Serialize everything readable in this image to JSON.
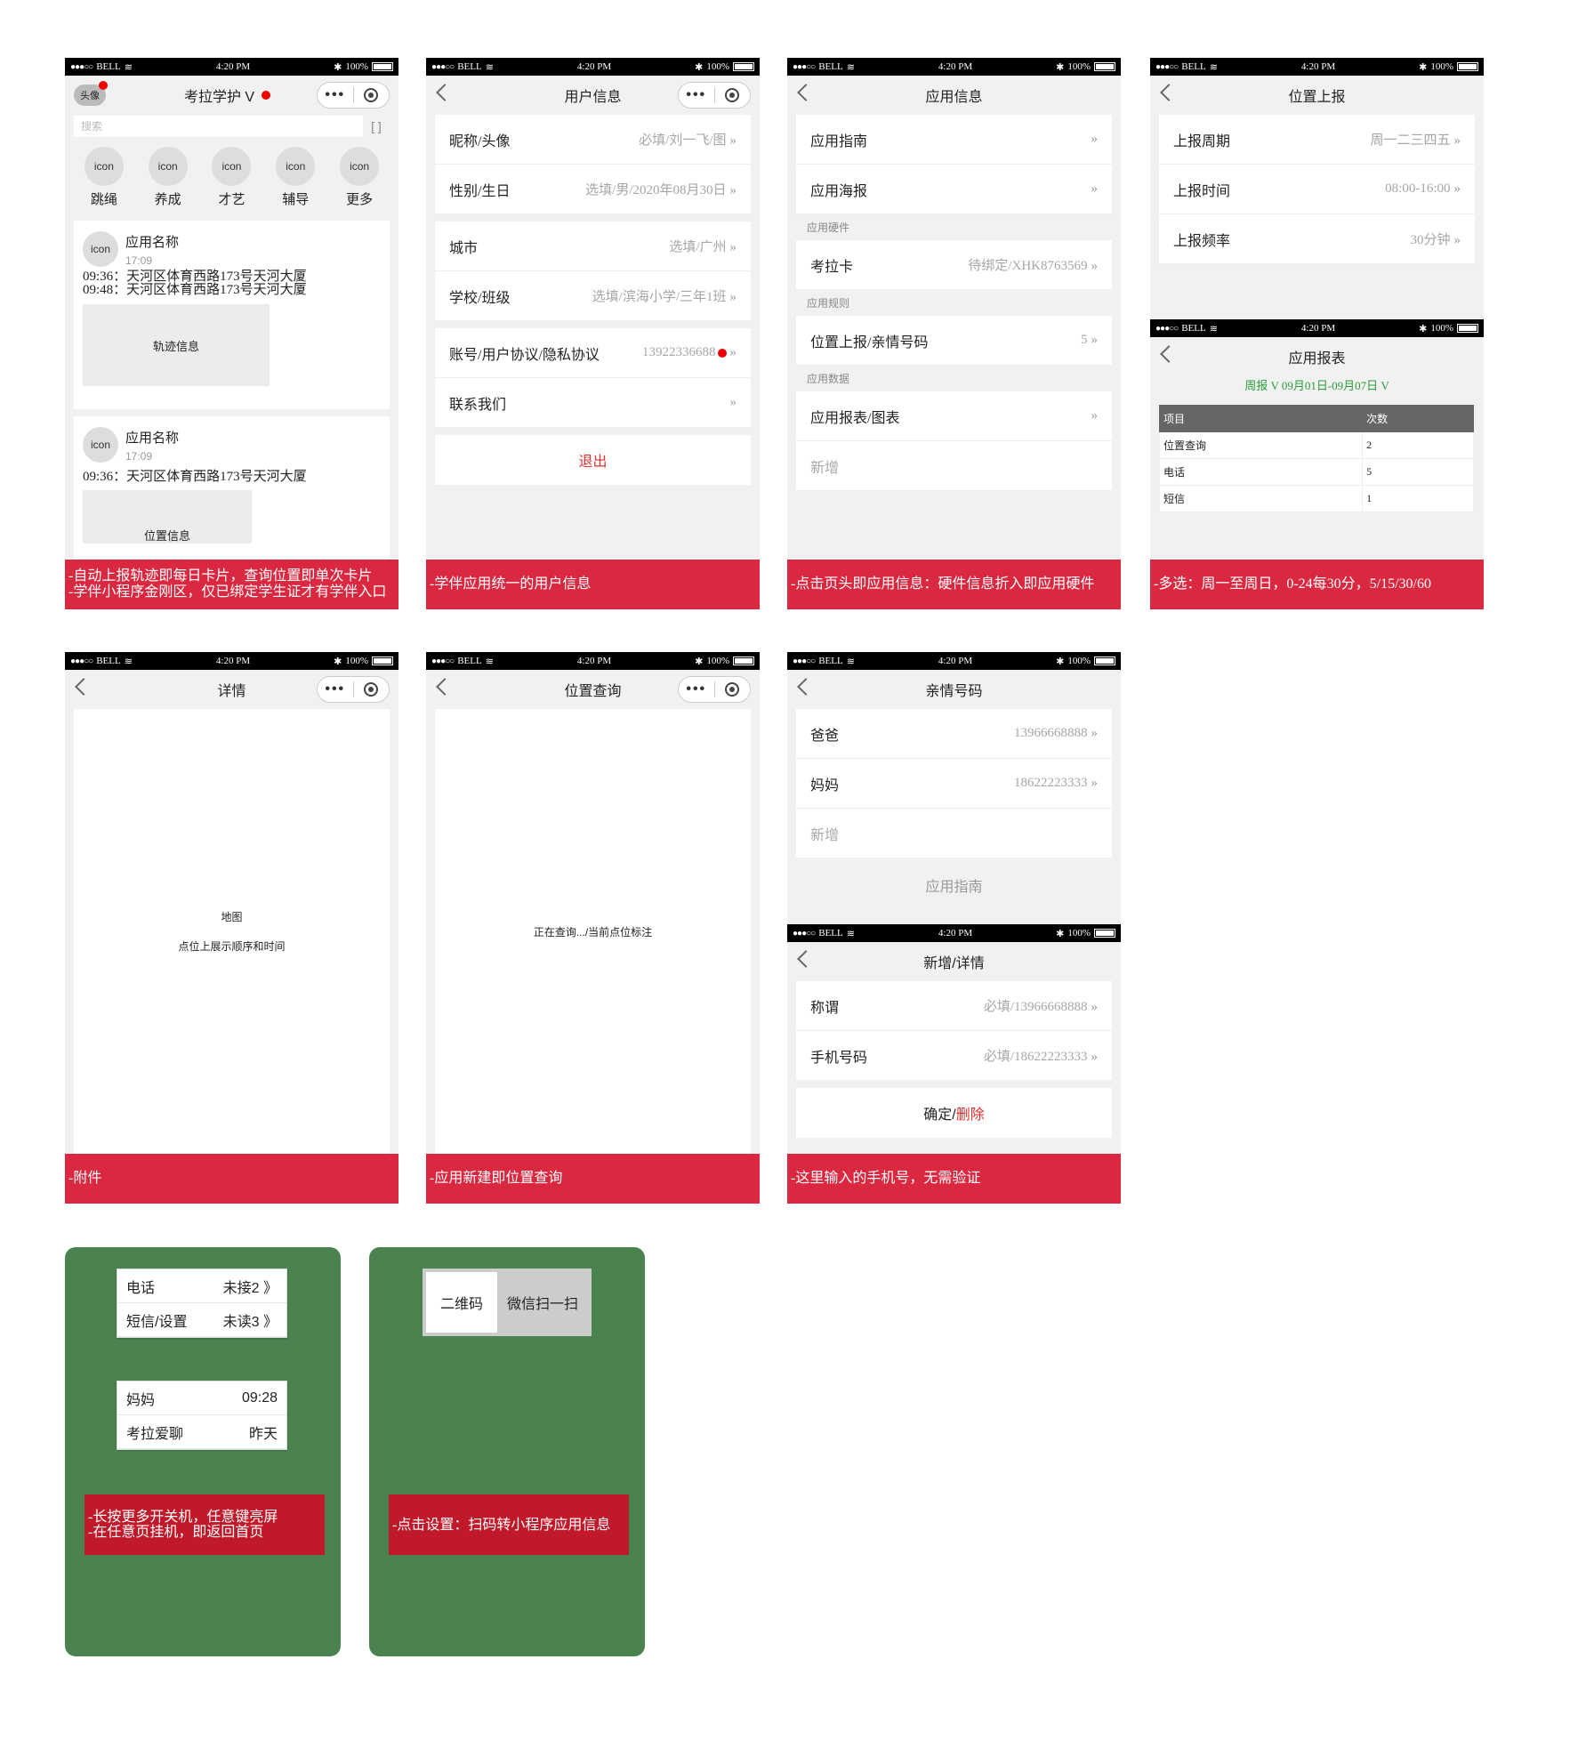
{
  "status": {
    "carrier": "BELL",
    "time": "4:20 PM",
    "battery": "100%"
  },
  "capsule": {
    "more": "•••"
  },
  "home": {
    "avatar": "头像",
    "title": "考拉学护 V",
    "search_placeholder": "搜索",
    "scan_label": "[ ]",
    "apps": [
      {
        "icon": "icon",
        "label": "跳绳"
      },
      {
        "icon": "icon",
        "label": "养成"
      },
      {
        "icon": "icon",
        "label": "才艺"
      },
      {
        "icon": "icon",
        "label": "辅导"
      },
      {
        "icon": "icon",
        "label": "更多"
      }
    ],
    "cards": [
      {
        "icon": "icon",
        "name": "应用名称",
        "time": "17:09",
        "lines": [
          "09:36：天河区体育西路173号天河大厦",
          "09:48：天河区体育西路173号天河大厦"
        ],
        "box": "轨迹信息"
      },
      {
        "icon": "icon",
        "name": "应用名称",
        "time": "17:09",
        "lines": [
          "09:36：天河区体育西路173号天河大厦"
        ],
        "box": "位置信息"
      }
    ],
    "banner": [
      "-自动上报轨迹即每日卡片，查询位置即单次卡片",
      "-学伴小程序金刚区，仅已绑定学生证才有学伴入口"
    ]
  },
  "user_info": {
    "title": "用户信息",
    "rows": [
      {
        "label": "昵称/头像",
        "value": "必填/刘一飞/图"
      },
      {
        "label": "性别/生日",
        "value": "选填/男/2020年08月30日"
      },
      {
        "label": "城市",
        "value": "选填/广州"
      },
      {
        "label": "学校/班级",
        "value": "选填/滨海小学/三年1班"
      },
      {
        "label": "账号/用户协议/隐私协议",
        "value": "13922336688"
      },
      {
        "label": "联系我们",
        "value": ""
      }
    ],
    "logout": "退出",
    "banner": "-学伴应用统一的用户信息"
  },
  "app_info": {
    "title": "应用信息",
    "guide": "应用指南",
    "poster": "应用海报",
    "hw_section": "应用硬件",
    "card_label": "考拉卡",
    "card_value": "待绑定/XHK8763569",
    "rule_section": "应用规则",
    "rule_label": "位置上报/亲情号码",
    "rule_value": "5",
    "data_section": "应用数据",
    "report_label": "应用报表/图表",
    "add": "新增",
    "banner": "-点击页头即应用信息：硬件信息折入即应用硬件"
  },
  "location_report": {
    "title": "位置上报",
    "rows": [
      {
        "label": "上报周期",
        "value": "周一二三四五"
      },
      {
        "label": "上报时间",
        "value": "08:00-16:00"
      },
      {
        "label": "上报频率",
        "value": "30分钟"
      }
    ]
  },
  "app_report": {
    "title": "应用报表",
    "filter": "周报 V  09月01日-09月07日 V",
    "headers": [
      "项目",
      "次数"
    ],
    "rows": [
      [
        "位置查询",
        "2"
      ],
      [
        "电话",
        "5"
      ],
      [
        "短信",
        "1"
      ]
    ],
    "banner": "-多选：周一至周日，0-24每30分，5/15/30/60"
  },
  "detail": {
    "title": "详情",
    "map": "地图",
    "map_note": "点位上展示顺序和时间",
    "banner": "-附件"
  },
  "location_query": {
    "title": "位置查询",
    "note": "正在查询.../当前点位标注",
    "banner": "-应用新建即位置查询"
  },
  "family": {
    "title": "亲情号码",
    "rows": [
      {
        "label": "爸爸",
        "value": "13966668888"
      },
      {
        "label": "妈妈",
        "value": "18622223333"
      }
    ],
    "add": "新增",
    "guide": "应用指南"
  },
  "family_edit": {
    "title": "新增/详情",
    "rows": [
      {
        "label": "称谓",
        "value": "必填/13966668888"
      },
      {
        "label": "手机号码",
        "value": "必填/18622223333"
      }
    ],
    "confirm": "确定/",
    "delete": "删除",
    "banner": "-这里输入的手机号，无需验证"
  },
  "watch1": {
    "popup1": [
      {
        "label": "电话",
        "value": "未接2 》"
      },
      {
        "label": "短信/设置",
        "value": "未读3 》"
      }
    ],
    "popup2": [
      {
        "label": "妈妈",
        "value": "09:28"
      },
      {
        "label": "考拉爱聊",
        "value": "昨天"
      }
    ],
    "banner": [
      "-长按更多开关机，任意键亮屏",
      "-在任意页挂机，即返回首页"
    ]
  },
  "watch2": {
    "qr": "二维码",
    "scan": "微信扫一扫",
    "banner": "-点击设置：扫码转小程序应用信息"
  },
  "colors": {
    "banner": "#d9283f",
    "green": "#4a8350",
    "dark_banner": "#c0192a",
    "filter_green": "#2a9d3a"
  }
}
